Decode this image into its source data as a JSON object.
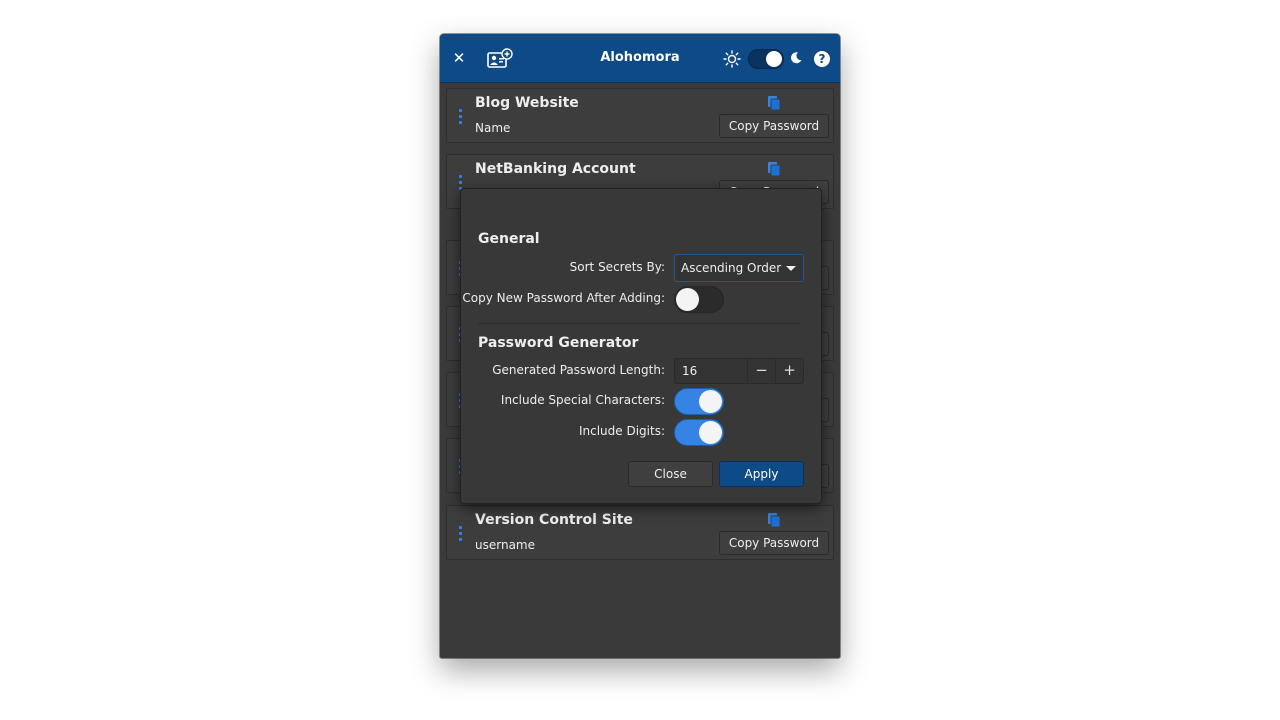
{
  "window": {
    "title": "Alohomora",
    "close_icon": "close-icon",
    "add_icon": "add-secret-icon",
    "theme_light_icon": "sun-icon",
    "theme_dark_icon": "moon-icon",
    "help_label": "?",
    "accent": "#0e4a86"
  },
  "secrets": [
    {
      "name": "Blog Website",
      "username": "Name",
      "copy_label": "Copy Password"
    },
    {
      "name": "NetBanking Account",
      "username": "",
      "copy_label": "Copy Password"
    },
    {
      "name": "Version Control Site",
      "username": "username",
      "copy_label": "Copy Password"
    }
  ],
  "preferences": {
    "general_title": "General",
    "sort_label": "Sort Secrets By:",
    "sort_value": "Ascending Order",
    "copy_new_label": "Copy New Password After Adding:",
    "copy_new_enabled": false,
    "generator_title": "Password Generator",
    "length_label": "Generated Password Length:",
    "length_value": "16",
    "special_label": "Include Special Characters:",
    "special_enabled": true,
    "digits_label": "Include Digits:",
    "digits_enabled": true,
    "minus_label": "−",
    "plus_label": "+",
    "close_label": "Close",
    "apply_label": "Apply"
  }
}
